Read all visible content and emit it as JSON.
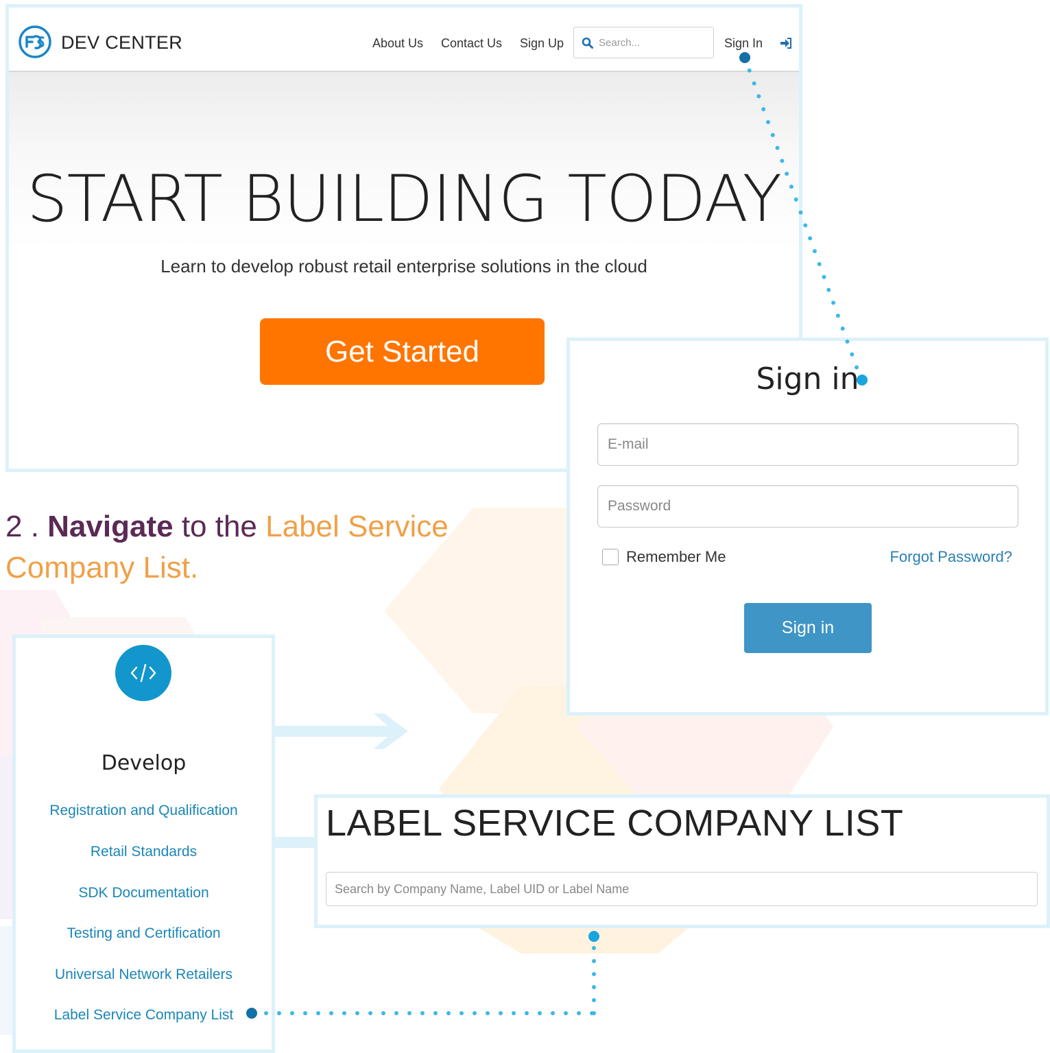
{
  "header": {
    "brand": "DEV CENTER",
    "nav": [
      "About Us",
      "Contact Us",
      "Sign Up"
    ],
    "search_placeholder": "Search...",
    "sign_in_link": "Sign In"
  },
  "hero": {
    "title": "START BUILDING TODAY",
    "subtitle": "Learn to develop robust retail enterprise solutions in the cloud",
    "cta": "Get Started"
  },
  "signin": {
    "title": "Sign in",
    "email_placeholder": "E-mail",
    "password_placeholder": "Password",
    "remember": "Remember Me",
    "forgot": "Forgot Password?",
    "button": "Sign in"
  },
  "step": {
    "number": "2 .",
    "verb": "Navigate",
    "mid": "to the",
    "target": "Label Service Company List."
  },
  "develop": {
    "heading": "Develop",
    "links": [
      "Registration and Qualification",
      "Retail Standards",
      "SDK Documentation",
      "Testing and Certification",
      "Universal Network Retailers",
      "Label Service Company List"
    ]
  },
  "lscl": {
    "title": "LABEL SERVICE COMPANY LIST",
    "search_placeholder": "Search by Company Name, Label UID or Label Name"
  },
  "colors": {
    "accent_orange": "#ff7500",
    "link_blue": "#1a86b7",
    "button_blue": "#3e95c6",
    "connector": "#3cb8e8",
    "panel_border": "#dcf1fa",
    "step_purple": "#5a2a55",
    "step_orange": "#f0a048"
  },
  "icons": [
    "brand-logo",
    "search-icon",
    "sign-in-icon",
    "code-icon"
  ]
}
